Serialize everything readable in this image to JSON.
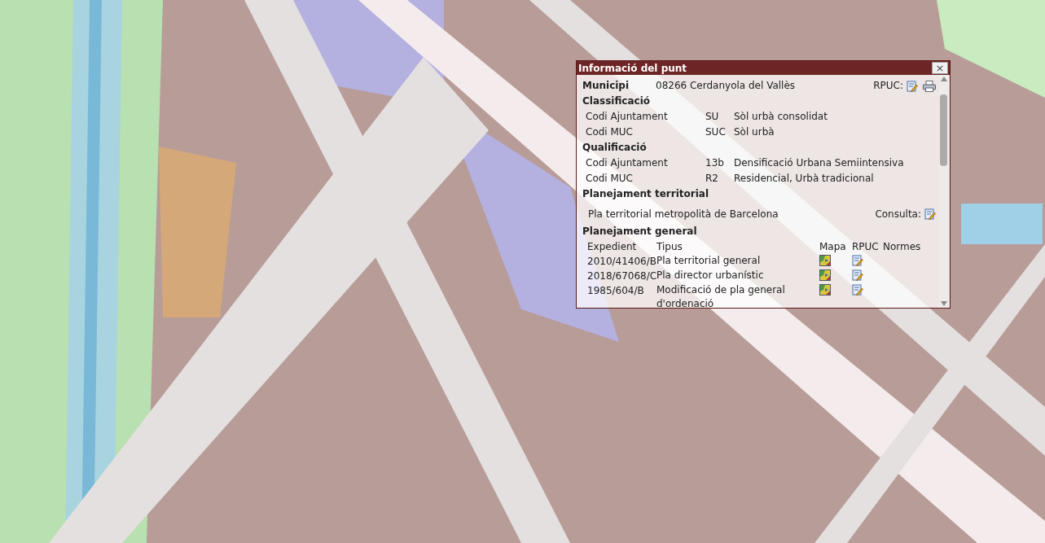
{
  "popup": {
    "title": "Informació del punt",
    "close": "×",
    "municipi": {
      "label": "Municipi",
      "value": "08266 Cerdanyola del Vallès",
      "rpuc_label": "RPUC:"
    },
    "sections": [
      {
        "heading": "Classificació",
        "rows": [
          {
            "label": "Codi Ajuntament",
            "code": "SU",
            "description": "Sòl urbà consolidat"
          },
          {
            "label": "Codi MUC",
            "code": "SUC",
            "description": "Sòl urbà"
          }
        ]
      },
      {
        "heading": "Qualificació",
        "rows": [
          {
            "label": "Codi Ajuntament",
            "code": "13b",
            "description": "Densificació Urbana Semiintensiva"
          },
          {
            "label": "Codi MUC",
            "code": "R2",
            "description": "Residencial, Urbà tradicional"
          }
        ]
      }
    ],
    "territorial": {
      "heading": "Planejament territorial",
      "text": "Pla territorial metropolità de Barcelona",
      "consulta": "Consulta:"
    },
    "general": {
      "heading": "Planejament general",
      "columns": [
        "Expedient",
        "Tipus",
        "Mapa",
        "RPUC",
        "Normes"
      ],
      "rows": [
        {
          "expedient": "2010/41406/B",
          "tipus": "Pla territorial general"
        },
        {
          "expedient": "2018/67068/C",
          "tipus": "Pla director urbanístic"
        },
        {
          "expedient": "1985/604/B",
          "tipus": "Modificació de pla general d'ordenació"
        }
      ]
    }
  }
}
